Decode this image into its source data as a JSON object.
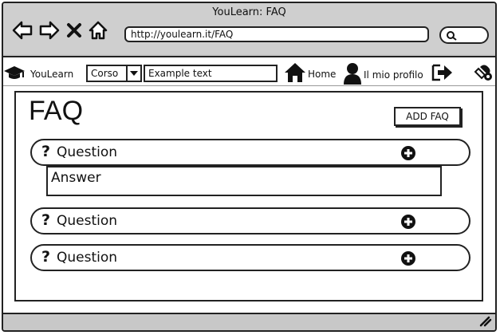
{
  "window": {
    "title": "YouLearn: FAQ"
  },
  "browser": {
    "url": "http://youlearn.it/FAQ",
    "icons": [
      "back-icon",
      "forward-icon",
      "close-icon",
      "home-icon",
      "search-icon"
    ]
  },
  "toolbar": {
    "brand": "YouLearn",
    "select_value": "Corso",
    "text_value": "Example text",
    "home_label": "Home",
    "profile_label": "Il mio profilo"
  },
  "main": {
    "title": "FAQ",
    "add_button": "ADD FAQ",
    "questions": [
      {
        "label": "Question",
        "answer": "Answer"
      },
      {
        "label": "Question"
      },
      {
        "label": "Question"
      }
    ]
  }
}
